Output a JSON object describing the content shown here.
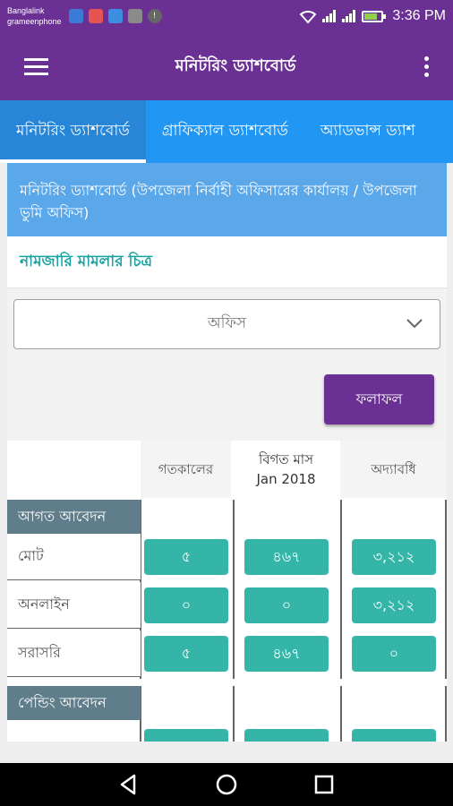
{
  "status_bar": {
    "carrier_line1": "Banglalink",
    "carrier_line2": "grameenphone",
    "time": "3:36 PM"
  },
  "app_bar": {
    "title": "মনিটরিং ড্যাশবোর্ড"
  },
  "tabs": [
    {
      "label": "মনিটরিং ড্যাশবোর্ড",
      "active": true
    },
    {
      "label": "গ্রাফিক্যাল ড্যাশবোর্ড",
      "active": false
    },
    {
      "label": "অ্যাডভান্স ড্যাশ",
      "active": false
    }
  ],
  "banner": {
    "text": "মনিটরিং ড্যাশবোর্ড (উপজেলা নির্বাহী অফিসারের কার্যালয় / উপজেলা ভুমি অফিস)"
  },
  "section": {
    "title": "নামজারি মামলার চিত্র"
  },
  "filter": {
    "office_select_value": "অফিস",
    "result_button": "ফলাফল"
  },
  "table": {
    "columns": {
      "yesterday": "গতকালের",
      "last_month_line1": "বিগত মাস",
      "last_month_line2": "Jan 2018",
      "to_date": "অদ্যাবধি"
    },
    "categories": {
      "received": "আগত আবেদন",
      "pending": "পেন্ডিং আবেদন"
    },
    "rows": [
      {
        "label": "মোট",
        "values": [
          "৫",
          "৪৬৭",
          "৩,২১২"
        ]
      },
      {
        "label": "অনলাইন",
        "values": [
          "০",
          "০",
          "৩,২১২"
        ]
      },
      {
        "label": "সরাসরি",
        "values": [
          "৫",
          "৪৬৭",
          "০"
        ]
      }
    ]
  },
  "colors": {
    "primary": "#6b3094",
    "tab_bar": "#2196f3",
    "banner": "#5aa7ea",
    "accent_teal": "#35b5a8",
    "category_header": "#607d8b"
  }
}
